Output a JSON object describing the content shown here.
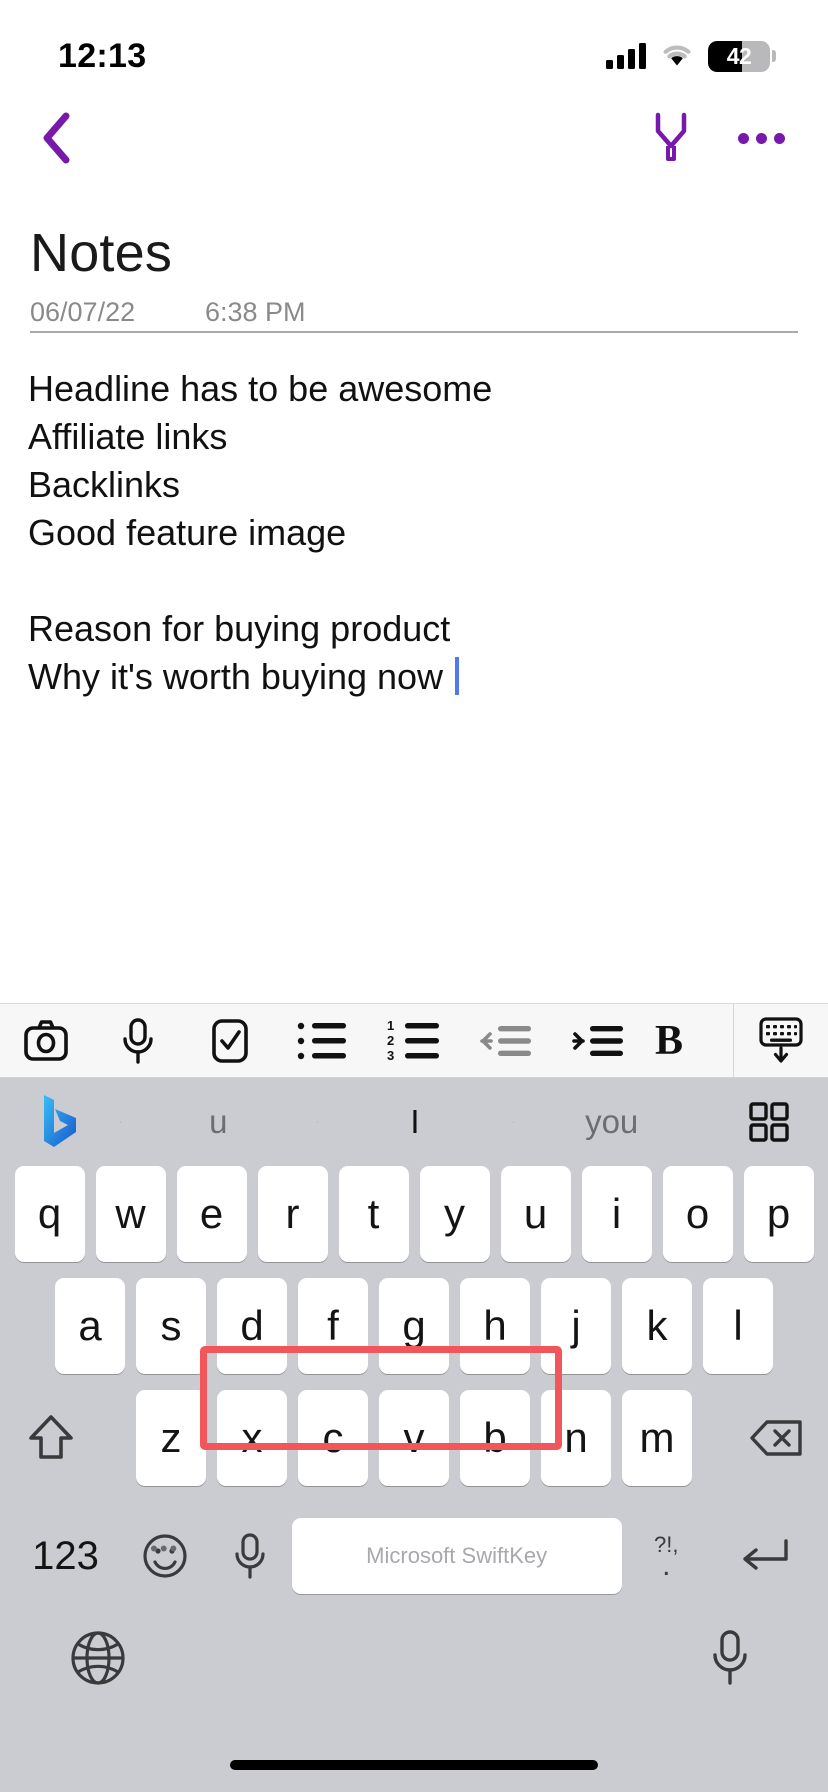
{
  "status_bar": {
    "time": "12:13",
    "battery_level": "42",
    "icons": {
      "signal": "signal-bars-icon",
      "wifi": "wifi-icon",
      "battery": "battery-icon"
    }
  },
  "app_bar": {
    "back": "back-chevron-icon",
    "highlighter": "highlighter-pen-icon",
    "more": "more-options-icon"
  },
  "note": {
    "title": "Notes",
    "date": "06/07/22",
    "time": "6:38 PM",
    "lines": [
      "Headline has to be awesome",
      "Affiliate links",
      "Backlinks",
      "Good feature image",
      "",
      "Reason for buying product",
      "Why it's worth buying now"
    ],
    "cursor_on_line": 6
  },
  "format_toolbar": {
    "items": [
      {
        "name": "camera-icon",
        "label": "Camera"
      },
      {
        "name": "microphone-icon",
        "label": "Voice"
      },
      {
        "name": "checkbox-icon",
        "label": "To-do"
      },
      {
        "name": "bullet-list-icon",
        "label": "Bullets"
      },
      {
        "name": "numbered-list-icon",
        "label": "Numbering"
      },
      {
        "name": "outdent-icon",
        "label": "Decrease indent"
      },
      {
        "name": "indent-icon",
        "label": "Increase indent"
      },
      {
        "name": "bold-icon",
        "label": "Bold"
      }
    ],
    "hide_keyboard": {
      "name": "hide-keyboard-icon",
      "label": "Hide keyboard"
    }
  },
  "keyboard": {
    "brand": "Microsoft SwiftKey",
    "logo": "bing-logo-icon",
    "suggestions": [
      "u",
      "I",
      "you"
    ],
    "grid_icon": "keyboard-menu-grid-icon",
    "row1": [
      "q",
      "w",
      "e",
      "r",
      "t",
      "y",
      "u",
      "i",
      "o",
      "p"
    ],
    "row2": [
      "a",
      "s",
      "d",
      "f",
      "g",
      "h",
      "j",
      "k",
      "l"
    ],
    "row3": [
      "z",
      "x",
      "c",
      "v",
      "b",
      "n",
      "m"
    ],
    "shift_key": "shift-icon",
    "backspace_key": "backspace-icon",
    "numbers_key": "123",
    "emoji_key": "emoji-icon",
    "mic_key": "microphone-icon",
    "space_label": "Microsoft SwiftKey",
    "punctuation_key_top": "?!,",
    "punctuation_key_bottom": ".",
    "return_key": "return-icon",
    "globe_key": "globe-language-icon",
    "dictation_key": "dictation-microphone-icon"
  },
  "annotation": {
    "highlight_color": "#f0565a",
    "target": "space-bar"
  },
  "colors": {
    "accent": "#7719aa",
    "caret": "#5078f0",
    "keyboard_bg": "#cbccd2",
    "key_bg": "#ffffff",
    "toolbar_bg": "#f7f7f7"
  }
}
